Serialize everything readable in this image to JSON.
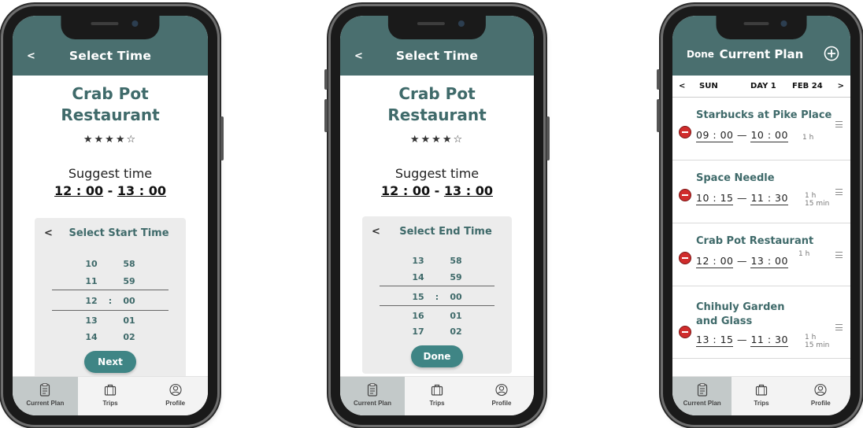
{
  "phones": {
    "start": {
      "header": {
        "back": "<",
        "title": "Select  Time"
      },
      "restaurant_line1": "Crab Pot",
      "restaurant_line2": "Restaurant",
      "rating": "★★★★☆",
      "suggest_label": "Suggest time",
      "suggest_start": "12 : 00",
      "suggest_sep": " - ",
      "suggest_end": "13 : 00",
      "picker": {
        "back": "<",
        "title": "Select Start Time",
        "rows": [
          [
            "10",
            "58"
          ],
          [
            "11",
            "59"
          ],
          [
            "12",
            "00"
          ],
          [
            "13",
            "01"
          ],
          [
            "14",
            "02"
          ]
        ],
        "colon": ":",
        "button": "Next"
      }
    },
    "end": {
      "header": {
        "back": "<",
        "title": "Select Time"
      },
      "restaurant_line1": "Crab Pot",
      "restaurant_line2": "Restaurant",
      "rating": "★★★★☆",
      "suggest_label": "Suggest time",
      "suggest_start": "12 : 00",
      "suggest_sep": " - ",
      "suggest_end": "13 : 00",
      "picker": {
        "back": "<",
        "title": "Select End Time",
        "rows": [
          [
            "13",
            "58"
          ],
          [
            "14",
            "59"
          ],
          [
            "15",
            "00"
          ],
          [
            "16",
            "01"
          ],
          [
            "17",
            "02"
          ]
        ],
        "colon": ":",
        "button": "Done"
      }
    },
    "plan": {
      "header": {
        "done": "Done",
        "title": "Current Plan",
        "add_icon": "plus-circle-icon"
      },
      "day_bar": {
        "prev": "<",
        "weekday": "SUN",
        "day": "DAY 1",
        "date": "FEB 24",
        "next": ">"
      },
      "items": [
        {
          "name": "Starbucks at Pike Place",
          "start": "09 : 00",
          "dash": "—",
          "end": "10 : 00",
          "dur1": "1 h",
          "dur2": ""
        },
        {
          "name": "Space Needle",
          "start": "10 : 15",
          "dash": "—",
          "end": "11 : 30",
          "dur1": "1 h",
          "dur2": "15 min"
        },
        {
          "name": "Crab Pot Restaurant",
          "start": "12 : 00",
          "dash": "—",
          "end": "13 : 00",
          "dur1": "1 h",
          "dur2": ""
        },
        {
          "name": "Chihuly Garden and Glass",
          "start": "13 : 15",
          "dash": "—",
          "end": "11 : 30",
          "dur1": "1 h",
          "dur2": "15 min"
        }
      ]
    }
  },
  "tabbar": {
    "items": [
      {
        "label": "Current Plan",
        "icon": "clipboard-icon"
      },
      {
        "label": "Trips",
        "icon": "suitcase-icon"
      },
      {
        "label": "Profile",
        "icon": "user-icon"
      }
    ]
  },
  "colors": {
    "header": "#4a6f6f",
    "accent": "#3f6a6a",
    "button": "#3f8585",
    "delete": "#d02c2c"
  }
}
